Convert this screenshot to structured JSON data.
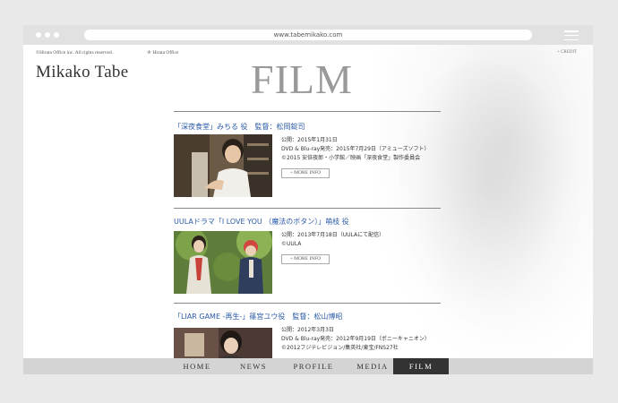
{
  "browser": {
    "url": "www.tabemikako.com"
  },
  "header": {
    "copyright": "©Hirata Office inc. All rights reserved.",
    "office_logo": "Hirata Office",
    "credit": "+ CREDIT",
    "brand": "Mikako Tabe",
    "page_title": "FILM"
  },
  "films": [
    {
      "title": "「深夜食堂」みちる 役　監督：松岡錠司",
      "lines": [
        "公開：2015年1月31日",
        "DVD & Blu-ray発売：2015年7月29日（アミューズソフト）",
        "©2015 安倍夜郎・小学館／映画「深夜食堂」製作委員会"
      ],
      "more": "+ MORE INFO"
    },
    {
      "title": "UULAドラマ「I LOVE YOU （魔法のボタン）」萌枝 役",
      "lines": [
        "公開：2013年7月18日（UULAにて配信）",
        "©UULA"
      ],
      "more": "+ MORE INFO"
    },
    {
      "title": "「LIAR GAME -再生-」篠宮ユウ役　監督：松山博昭",
      "lines": [
        "公開：2012年3月3日",
        "DVD & Blu-ray発売：2012年9月19日（ポニーキャニオン）",
        "©2012フジテレビジョン/集英社/東宝/FNS27社"
      ],
      "more": ""
    }
  ],
  "nav": {
    "items": [
      "HOME",
      "NEWS",
      "PROFILE",
      "MEDIA",
      "FILM"
    ],
    "active": "FILM"
  },
  "colors": {
    "link": "#2b5aa8",
    "nav_bg": "#d4d4d4",
    "nav_active": "#333333"
  }
}
